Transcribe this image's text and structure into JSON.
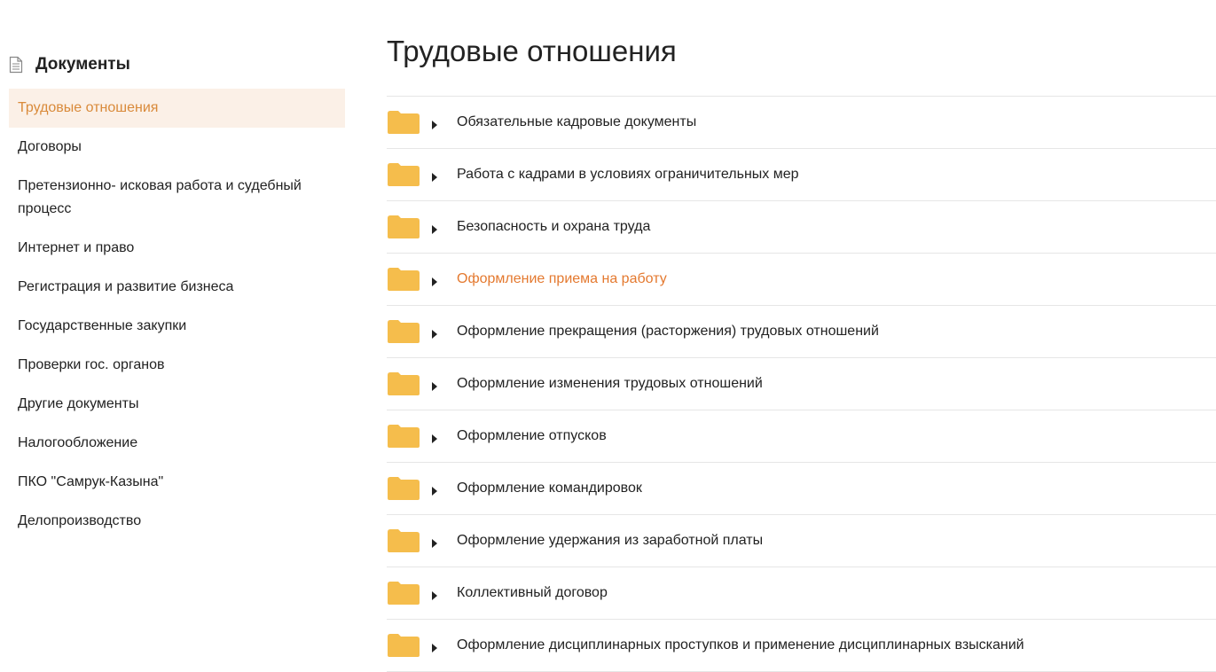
{
  "sidebar": {
    "title": "Документы",
    "items": [
      {
        "label": "Трудовые отношения",
        "active": true
      },
      {
        "label": "Договоры"
      },
      {
        "label": "Претензионно- исковая работа и судебный процесс"
      },
      {
        "label": "Интернет и право"
      },
      {
        "label": "Регистрация и развитие бизнеса"
      },
      {
        "label": "Государственные закупки"
      },
      {
        "label": "Проверки гос. органов"
      },
      {
        "label": "Другие документы"
      },
      {
        "label": "Налогообложение"
      },
      {
        "label": "ПКО \"Самрук-Казына\""
      },
      {
        "label": "Делопроизводство"
      }
    ]
  },
  "main": {
    "title": "Трудовые отношения",
    "folders": [
      {
        "label": "Обязательные кадровые документы"
      },
      {
        "label": "Работа с кадрами в условиях ограничительных мер"
      },
      {
        "label": "Безопасность и охрана труда"
      },
      {
        "label": "Оформление приема на работу",
        "highlight": true
      },
      {
        "label": "Оформление прекращения (расторжения) трудовых отношений"
      },
      {
        "label": "Оформление изменения трудовых отношений"
      },
      {
        "label": "Оформление отпусков"
      },
      {
        "label": "Оформление командировок"
      },
      {
        "label": "Оформление удержания из заработной платы"
      },
      {
        "label": "Коллективный договор"
      },
      {
        "label": "Оформление дисциплинарных проступков и применение дисциплинарных взысканий"
      }
    ]
  },
  "colors": {
    "accent": "#e4792f",
    "active_bg": "#fbf0e7",
    "folder": "#f5bd4c"
  },
  "icons": {
    "sidebar": "document-icon",
    "folder": "folder-icon",
    "caret": "caret-right-icon"
  }
}
